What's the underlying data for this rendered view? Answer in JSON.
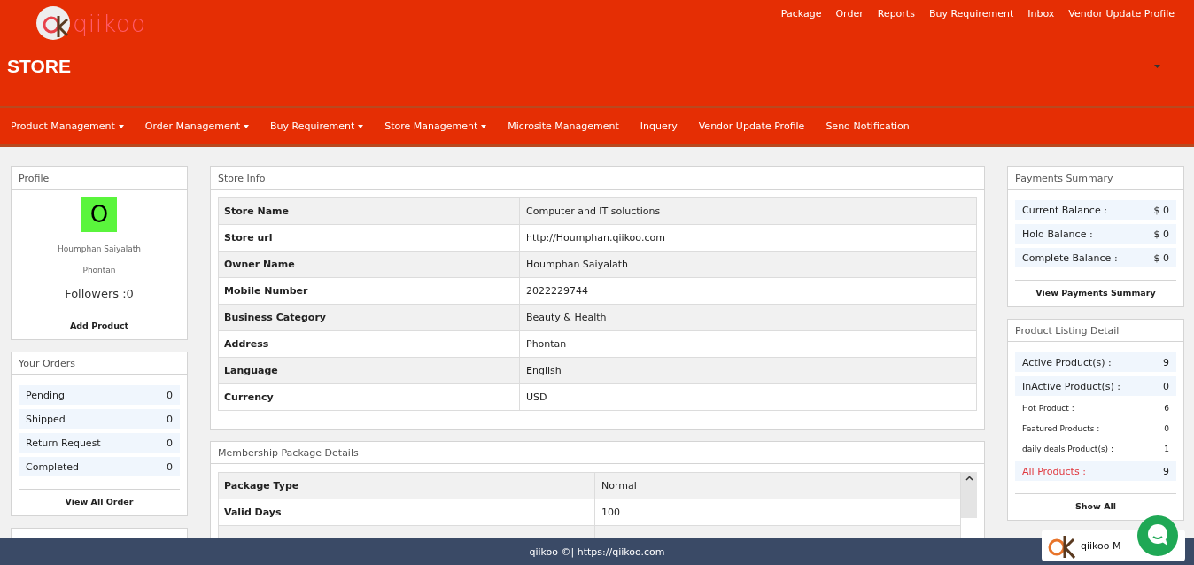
{
  "brand": {
    "name": "qiikoo"
  },
  "top_links": [
    "Package",
    "Order",
    "Reports",
    "Buy Requirement",
    "Inbox",
    "Vendor Update Profile"
  ],
  "page_title": "STORE",
  "nav": [
    {
      "label": "Product Management",
      "dropdown": true
    },
    {
      "label": "Order Management",
      "dropdown": true
    },
    {
      "label": "Buy Requirement",
      "dropdown": true
    },
    {
      "label": "Store Management",
      "dropdown": true
    },
    {
      "label": "Microsite Management",
      "dropdown": false
    },
    {
      "label": "Inquery",
      "dropdown": false
    },
    {
      "label": "Vendor Update Profile",
      "dropdown": false
    },
    {
      "label": "Send Notification",
      "dropdown": false
    }
  ],
  "profile": {
    "title": "Profile",
    "avatar_letter": "O",
    "name": "Houmphan Saiyalath",
    "location": "Phontan",
    "followers": "Followers :0",
    "action": "Add Product"
  },
  "orders": {
    "title": "Your Orders",
    "rows": [
      {
        "label": "Pending",
        "value": "0"
      },
      {
        "label": "Shipped",
        "value": "0"
      },
      {
        "label": "Return Request",
        "value": "0"
      },
      {
        "label": "Completed",
        "value": "0"
      }
    ],
    "action": "View All Order"
  },
  "store_info": {
    "title": "Store Info",
    "rows": [
      {
        "label": "Store Name",
        "value": "Computer and IT soluctions"
      },
      {
        "label": "Store url",
        "value": "http://Houmphan.qiikoo.com"
      },
      {
        "label": "Owner Name",
        "value": "Houmphan Saiyalath"
      },
      {
        "label": "Mobile Number",
        "value": "2022229744"
      },
      {
        "label": "Business Category",
        "value": "Beauty & Health"
      },
      {
        "label": "Address",
        "value": "Phontan"
      },
      {
        "label": "Language",
        "value": "English"
      },
      {
        "label": "Currency",
        "value": "USD"
      }
    ]
  },
  "membership": {
    "title": "Membership Package Details",
    "rows": [
      {
        "label": "Package Type",
        "value": "Normal"
      },
      {
        "label": "Valid Days",
        "value": "100"
      }
    ]
  },
  "payments": {
    "title": "Payments Summary",
    "rows": [
      {
        "label": "Current Balance :",
        "value": "$ 0"
      },
      {
        "label": "Hold Balance :",
        "value": "$ 0"
      },
      {
        "label": "Complete Balance :",
        "value": "$ 0"
      }
    ],
    "action": "View Payments Summary"
  },
  "listing": {
    "title": "Product Listing Detail",
    "rows": [
      {
        "kind": "band",
        "label": "Active Product(s) :",
        "value": "9"
      },
      {
        "kind": "band",
        "label": "InActive Product(s) :",
        "value": "0"
      },
      {
        "kind": "small",
        "label": "Hot Product :",
        "value": "6"
      },
      {
        "kind": "small",
        "label": "Featured Products :",
        "value": "0"
      },
      {
        "kind": "small",
        "label": "daily deals Product(s) :",
        "value": "1"
      },
      {
        "kind": "total",
        "label": "All Products :",
        "value": "9"
      }
    ],
    "action": "Show All"
  },
  "footer": "qiikoo ©| https://qiikoo.com",
  "chat_widget": {
    "label": "qiikoo M"
  }
}
